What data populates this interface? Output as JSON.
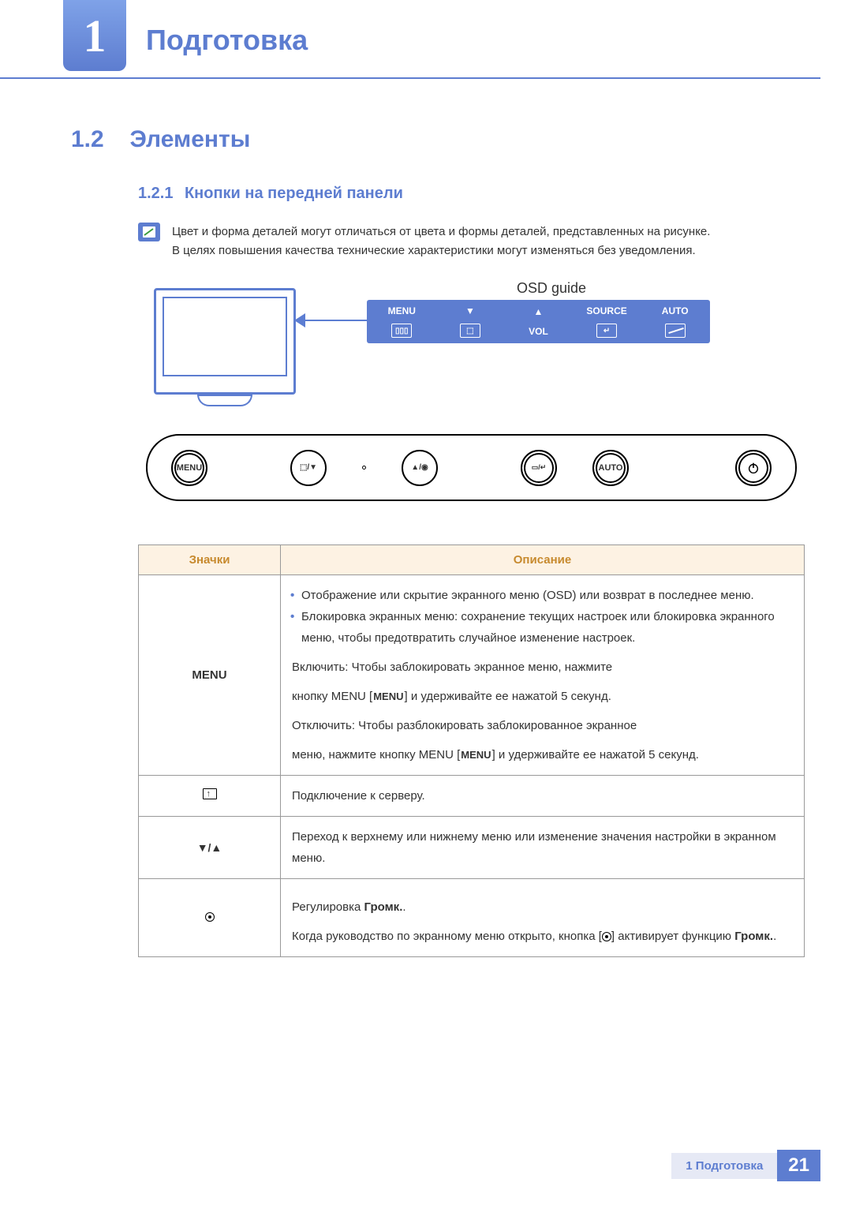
{
  "chapter": {
    "number": "1",
    "title": "Подготовка"
  },
  "section": {
    "number": "1.2",
    "title": "Элементы"
  },
  "subsection": {
    "number": "1.2.1",
    "title": "Кнопки на передней панели"
  },
  "note": {
    "line1": "Цвет и форма деталей могут отличаться от цвета и формы деталей, представленных на рисунке.",
    "line2": "В целях повышения качества технические характеристики могут изменяться без уведомления."
  },
  "diagram": {
    "osd_guide": "OSD guide",
    "osd_labels": [
      "MENU",
      "▼",
      "▲",
      "SOURCE",
      "AUTO"
    ],
    "osd_sub": [
      "",
      "",
      "VOL",
      "",
      ""
    ],
    "buttons": {
      "menu": "MENU",
      "auto": "AUTO"
    }
  },
  "table": {
    "headers": {
      "icons": "Значки",
      "desc": "Описание"
    },
    "rows": [
      {
        "icon_label": "MENU",
        "bullets": [
          "Отображение или скрытие экранного меню (OSD) или возврат в последнее меню.",
          "Блокировка экранных меню: сохранение текущих настроек или блокировка экранного меню, чтобы предотвратить случайное изменение настроек."
        ],
        "p1a": "Включить: Чтобы заблокировать экранное меню, нажмите",
        "p1b": "кнопку MENU [",
        "p1c": "MENU",
        "p1d": "] и удерживайте ее нажатой 5 секунд.",
        "p2a": "Отключить: Чтобы разблокировать заблокированное экранное",
        "p2b": "меню, нажмите кнопку MENU [",
        "p2c": "MENU",
        "p2d": "] и удерживайте ее нажатой 5 секунд."
      },
      {
        "icon_type": "server",
        "text": "Подключение к серверу."
      },
      {
        "icon_type": "arrows",
        "text": "Переход к верхнему или нижнему меню или изменение значения настройки в экранном меню."
      },
      {
        "icon_type": "record",
        "p1a": "Регулировка ",
        "p1b": "Громк.",
        "p1c": ".",
        "p2a": "Когда руководство по экранному меню открыто, кнопка [",
        "p2b": "] активирует функцию ",
        "p2c": "Громк.",
        "p2d": "."
      }
    ]
  },
  "footer": {
    "chapter_ref": "1 Подготовка",
    "page": "21"
  }
}
